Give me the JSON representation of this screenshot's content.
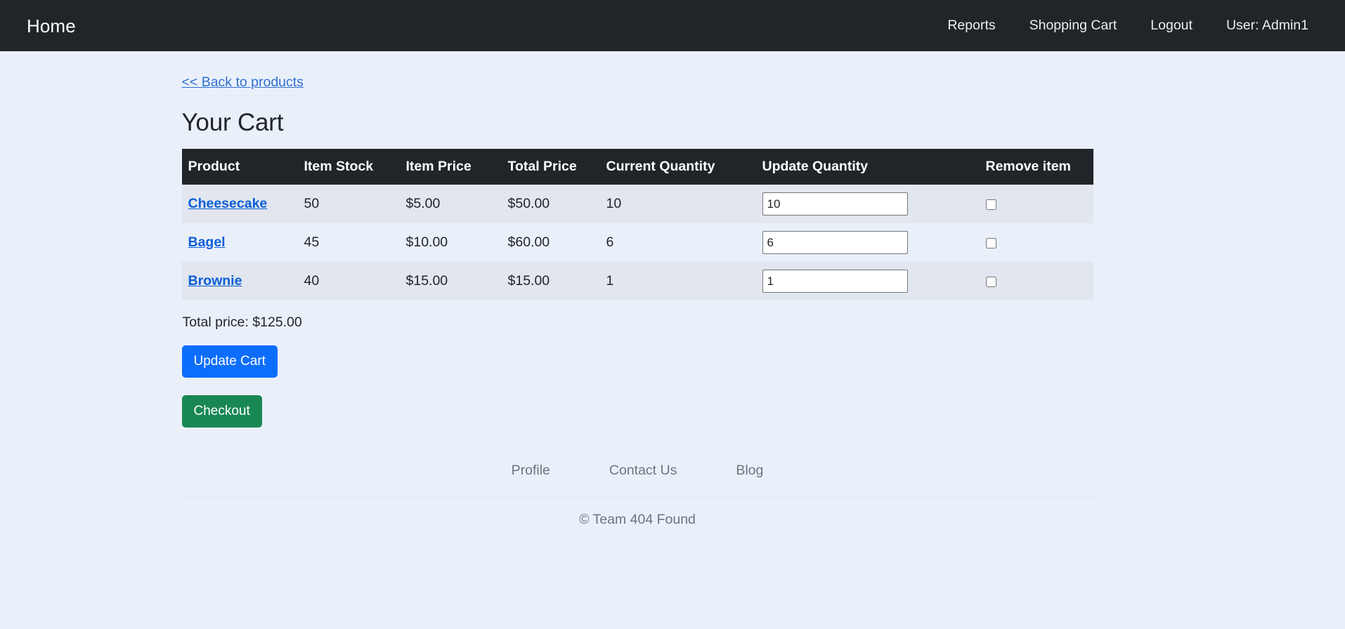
{
  "navbar": {
    "brand": "Home",
    "links": [
      {
        "label": "Reports",
        "name": "nav-reports"
      },
      {
        "label": "Shopping Cart",
        "name": "nav-shopping-cart"
      },
      {
        "label": "Logout",
        "name": "nav-logout"
      }
    ],
    "user": "User: Admin1",
    "background": "#212529"
  },
  "main": {
    "back_link": "<< Back to products",
    "title": "Your Cart",
    "table": {
      "headers": [
        "Product",
        "Item Stock",
        "Item Price",
        "Total Price",
        "Current Quantity",
        "Update Quantity",
        "Remove item"
      ],
      "rows": [
        {
          "product": "Cheesecake",
          "item_stock": "50",
          "item_price": "$5.00",
          "total_price": "$50.00",
          "current_quantity": "10",
          "update_quantity": "10",
          "remove_checked": false
        },
        {
          "product": "Bagel",
          "item_stock": "45",
          "item_price": "$10.00",
          "total_price": "$60.00",
          "current_quantity": "6",
          "update_quantity": "6",
          "remove_checked": false
        },
        {
          "product": "Brownie",
          "item_stock": "40",
          "item_price": "$15.00",
          "total_price": "$15.00",
          "current_quantity": "1",
          "update_quantity": "1",
          "remove_checked": false
        }
      ]
    },
    "total_price_label": "Total price: $125.00",
    "update_cart_button": "Update Cart",
    "checkout_button": "Checkout",
    "accent_primary": "#0d6efd",
    "accent_success": "#198754"
  },
  "footer": {
    "links": [
      {
        "label": "Profile",
        "name": "footer-profile"
      },
      {
        "label": "Contact Us",
        "name": "footer-contact-us"
      },
      {
        "label": "Blog",
        "name": "footer-blog"
      }
    ],
    "copyright": "© Team 404 Found"
  }
}
